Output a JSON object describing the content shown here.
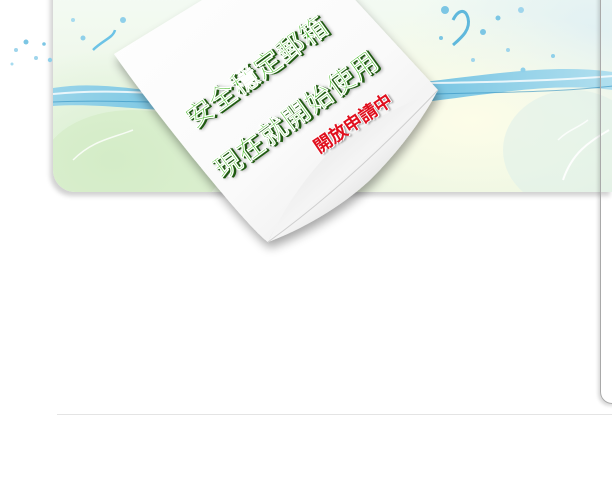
{
  "note": {
    "line1": "安全穩定郵箱",
    "line2": "現在就開始使用",
    "badge": "開放申請中"
  },
  "colors": {
    "green_text": "#3fb51f",
    "red_text": "#e0101e",
    "frame_border": "#a9a9a9",
    "water_blue": "#5fb8dc"
  },
  "icons": {
    "splash_left": "water-splash-icon",
    "splash_right": "water-splash-icon"
  }
}
